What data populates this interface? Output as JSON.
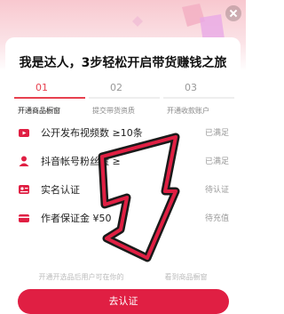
{
  "title": "我是达人，3步轻松开启带货赚钱之旅",
  "steps": [
    {
      "number": "01",
      "label": "开通商品橱窗"
    },
    {
      "number": "02",
      "label": "提交带货资质"
    },
    {
      "number": "03",
      "label": "开通收款账户"
    }
  ],
  "requirements": [
    {
      "label": "公开发布视频数 ≥10条",
      "status": "已满足",
      "icon": "video-icon"
    },
    {
      "label": "抖音帐号粉丝量 ≥",
      "status": "已满足",
      "icon": "user-icon"
    },
    {
      "label": "实名认证",
      "status": "待认证",
      "icon": "id-card-icon"
    },
    {
      "label": "作者保证金 ¥50",
      "status": "待充值",
      "icon": "deposit-icon"
    }
  ],
  "note": "开通开选品后用户可在你的",
  "note_tail": "看到商品橱窗",
  "button_label": "去认证",
  "colors": {
    "accent": "#e01f43",
    "arrow": "#e01f43"
  }
}
